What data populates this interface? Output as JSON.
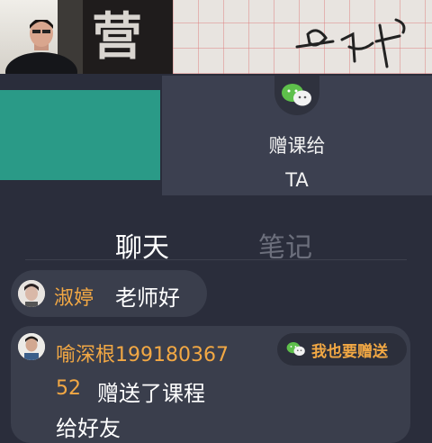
{
  "video": {
    "board_character": "营"
  },
  "gift_panel": {
    "line1": "赠课给",
    "line2": "TA"
  },
  "tabs": [
    {
      "label": "聊天"
    },
    {
      "label": "笔记"
    }
  ],
  "messages": [
    {
      "name": "淑婷",
      "text": "老师好"
    },
    {
      "name_line1": "喻深根199180367",
      "name_line2": "52",
      "text_line1": "赠送了课程",
      "text_line2": "给好友"
    }
  ],
  "gift_button": {
    "label": "我也要赠送",
    "icon": "wechat-icon"
  },
  "colors": {
    "accent": "#f2a844",
    "teal": "#2a9a87",
    "background": "#2a2d3b",
    "wechat_green": "#5ec04b"
  }
}
